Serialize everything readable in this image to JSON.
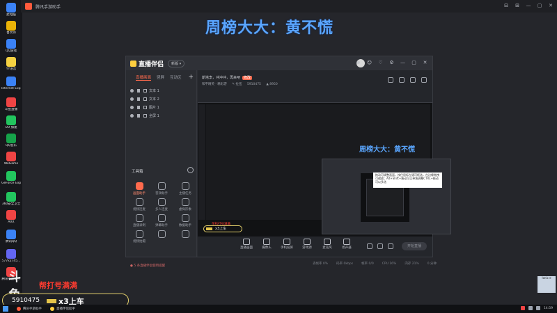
{
  "outer_window": {
    "title": "腾讯手游助手",
    "controls": [
      "⊟",
      "⊞",
      "—",
      "▢",
      "✕"
    ]
  },
  "desktop_icons": [
    {
      "label": "此电脑",
      "color": "#3b82f6"
    },
    {
      "label": "鲁大师",
      "color": "#eab308"
    },
    {
      "label": "QQ游戏",
      "color": "#3b82f6"
    },
    {
      "label": "YY语音",
      "color": "#f5d142"
    },
    {
      "label": "Internet Explorer",
      "color": "#3b82f6"
    },
    {
      "label": "斗鱼直播",
      "color": "#ef4444"
    },
    {
      "label": "UU 加速",
      "color": "#22c55e"
    },
    {
      "label": "QQ音乐",
      "color": "#16a34a"
    },
    {
      "label": "WeGame",
      "color": "#ef4444"
    },
    {
      "label": "GeForce Experience",
      "color": "#22c55e"
    },
    {
      "label": "360安全卫士",
      "color": "#22c55e"
    },
    {
      "label": "AXX",
      "color": "#ef4444"
    },
    {
      "label": "腾讯QQ",
      "color": "#3b82f6"
    },
    {
      "label": "577k2745...",
      "color": "#6366f1"
    },
    {
      "label": "腾讯手游助手",
      "color": "#ef4444"
    }
  ],
  "banner_text": "周榜大大：黄不慌",
  "app": {
    "logo": "直播伴侣",
    "badge": "新版 ▾",
    "tools": [
      "⊕",
      "☺",
      "♡",
      "⚙",
      "—",
      "▢",
      "✕"
    ],
    "left_tabs": [
      "直播画面",
      "竖屏",
      "互动区"
    ],
    "sources": [
      {
        "label": "文本 1"
      },
      {
        "label": "文本 2"
      },
      {
        "label": "图片 1"
      },
      {
        "label": "全屏 1"
      }
    ],
    "toolbox_title": "工具箱",
    "tools_grid": [
      {
        "label": "画面助手",
        "hot": true
      },
      {
        "label": "音效助手",
        "hot": false
      },
      {
        "label": "主播任务",
        "hot": false
      },
      {
        "label": "视频连麦",
        "hot": false
      },
      {
        "label": "多人连麦",
        "hot": false
      },
      {
        "label": "虚拟形象",
        "hot": false
      },
      {
        "label": "直播录制",
        "hot": false
      },
      {
        "label": "弹幕助手",
        "hot": false
      },
      {
        "label": "数据助手",
        "hot": false
      },
      {
        "label": "视频拍摄",
        "hot": false
      },
      {
        "label": "",
        "hot": false
      },
      {
        "label": "",
        "hot": false
      }
    ],
    "left_notice": "● 5 条直播伴侣使用提醒",
    "room_line": "斯塔李，冲冲冲，再来吧",
    "room_tag": "修改",
    "room_meta": [
      "和平精英 · 精彩游",
      "✎ 拉伍",
      "5910475",
      "▲ 8950"
    ],
    "preview_banner": "周榜大大：黄不慌",
    "tooltip_text": "拖动可调整画面，按住鼠标左键可框选，在边缘拖拽可缩放；Alt+Shift+拖动可以单独调整CTRL+拖动可以多选",
    "preview_alert": "单机打号满满",
    "preview_bar_text": "x3上车",
    "controls": [
      {
        "label": "直播画面"
      },
      {
        "label": "摄像头"
      },
      {
        "label": "手机投屏"
      },
      {
        "label": "游戏源"
      },
      {
        "label": "麦克风"
      },
      {
        "label": "扬声器"
      }
    ],
    "start_button": "开始直播",
    "status": [
      "丢帧率 0%",
      "码率 0kbps",
      "帧率 0/0",
      "CPU 16%",
      "内存 21%",
      "0 分钟"
    ]
  },
  "overlay": {
    "logo": "斗鱼",
    "alert": "帮打号满满",
    "room_number": "5910475",
    "room_text": "x3上车"
  },
  "mini_panel": "Ionic e",
  "taskbar": {
    "items": [
      "腾讯手游助手",
      "直播伴侣助手"
    ],
    "time": "14:59"
  }
}
